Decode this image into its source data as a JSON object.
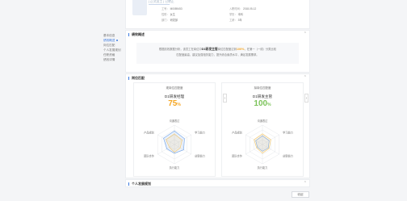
{
  "profile": {
    "sub_name": "| 正式员工 | 已转正",
    "fields": [
      {
        "label": "工号：",
        "value": "M0089453"
      },
      {
        "label": "性别：",
        "value": "女生"
      },
      {
        "label": "部门：",
        "value": "研发部"
      },
      {
        "label": "入职时间：",
        "value": "2018-05-12"
      },
      {
        "label": "学历：",
        "value": "本科"
      },
      {
        "label": "工龄：",
        "value": "3年"
      }
    ]
  },
  "sidebar": {
    "items": [
      {
        "label": "基本信息"
      },
      {
        "label": "绩效概述"
      },
      {
        "label": "岗位匹配"
      },
      {
        "label": "个人发展规划"
      },
      {
        "label": "任职资格"
      },
      {
        "label": "绩效详情"
      }
    ]
  },
  "overview": {
    "title": "绩效概述",
    "line1_pre": "根据绩效数据分析，该员工在岗位中",
    "line1_job": "D1研发主管",
    "line1_mid": "岗位匹配度达到",
    "line1_pct": "100%",
    "line1_post": "，在第一（一线）分类比较",
    "line2": "匹配度最高，建议加强相关能力，提升综合素质水平，满足发展需求。"
  },
  "match": {
    "title": "岗位匹配",
    "arrow_left": "‹",
    "arrow_right": "›",
    "panels": [
      {
        "caption": "现岗位匹配度",
        "job": "D1研发经理",
        "percent": "75",
        "unit": "%",
        "color": "#f5a623",
        "axes": [
          "沟通表达",
          "学习能力",
          "创新能力",
          "执行能力",
          "团队合作",
          "产品规划"
        ],
        "ability": [
          0.55,
          0.45,
          0.35,
          0.4,
          0.3,
          0.5
        ],
        "require": [
          0.7,
          0.6,
          0.55,
          0.45,
          0.45,
          0.65
        ]
      },
      {
        "caption": "拟岗位匹配度",
        "job": "D1研发主管",
        "percent": "100",
        "unit": "%",
        "color": "#7cc35a",
        "axes": [
          "沟通表达",
          "学习能力",
          "创新能力",
          "执行能力",
          "团队合作",
          "产品规划"
        ],
        "ability": [
          0.55,
          0.5,
          0.4,
          0.45,
          0.35,
          0.5
        ],
        "require": [
          0.45,
          0.4,
          0.35,
          0.35,
          0.3,
          0.4
        ]
      }
    ]
  },
  "performance": {
    "title": "个人发展规划"
  },
  "actions": {
    "button": "收起"
  },
  "colors": {
    "accent": "#3d7be0",
    "ability": "#f5c86b",
    "require": "#6fa3e8"
  }
}
